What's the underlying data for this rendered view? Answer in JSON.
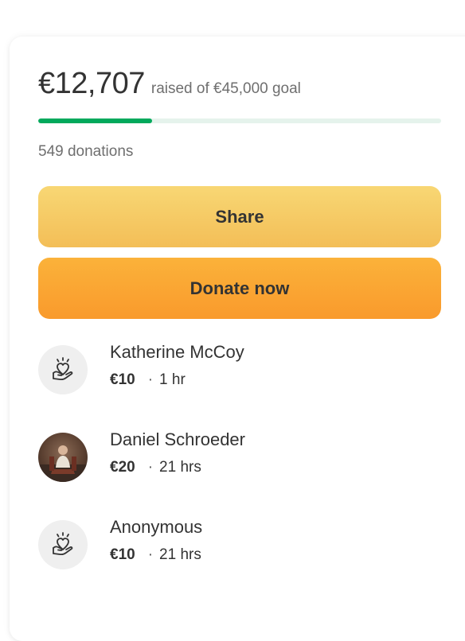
{
  "summary": {
    "raised_amount": "€12,707",
    "goal_text": "raised of €45,000 goal",
    "progress_fraction": 0.2824,
    "donations_count": "549 donations"
  },
  "buttons": {
    "share_label": "Share",
    "donate_label": "Donate now"
  },
  "donors": [
    {
      "name": "Katherine McCoy",
      "amount": "€10",
      "time": "1 hr",
      "avatar": "heart-hand-icon"
    },
    {
      "name": "Daniel Schroeder",
      "amount": "€20",
      "time": "21 hrs",
      "avatar": "profile-photo"
    },
    {
      "name": "Anonymous",
      "amount": "€10",
      "time": "21 hrs",
      "avatar": "heart-hand-icon"
    }
  ],
  "colors": {
    "progress_fill": "#02a95c",
    "progress_track": "#e5f3ec",
    "share_button": "#f5c865",
    "donate_button": "#faa634"
  }
}
